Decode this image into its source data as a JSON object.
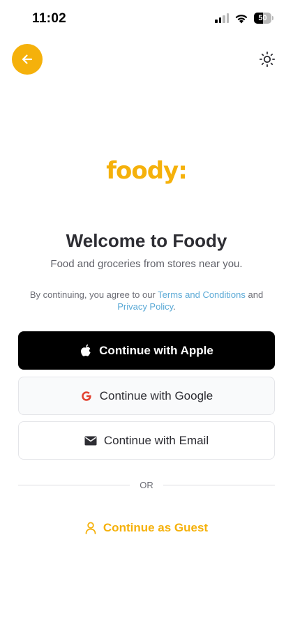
{
  "status_bar": {
    "time": "11:02",
    "battery": "50",
    "battery_level": 0.5
  },
  "header": {
    "back_icon": "arrow-left-icon",
    "theme_icon": "sun-icon"
  },
  "brand": {
    "logo_text": "foody:",
    "accent_color": "#f5b10b"
  },
  "welcome": {
    "title": "Welcome to Foody",
    "subtitle": "Food and groceries from stores near you."
  },
  "terms": {
    "prefix": "By continuing, you agree to our ",
    "terms_link": "Terms and Conditions",
    "middle": " and",
    "privacy_link": "Privacy Policy",
    "suffix": "."
  },
  "auth": {
    "apple_label": "Continue with Apple",
    "google_label": "Continue with Google",
    "email_label": "Continue with Email",
    "divider_label": "OR",
    "guest_label": "Continue as Guest"
  }
}
